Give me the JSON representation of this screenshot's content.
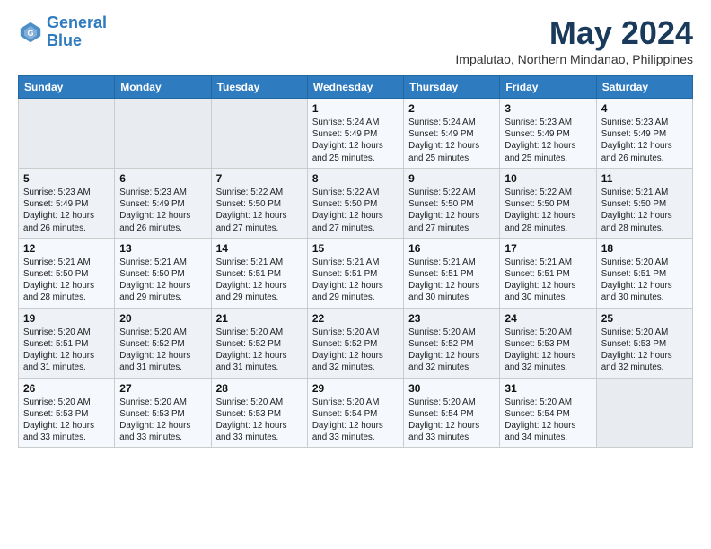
{
  "header": {
    "logo_line1": "General",
    "logo_line2": "Blue",
    "month_title": "May 2024",
    "subtitle": "Impalutao, Northern Mindanao, Philippines"
  },
  "days_of_week": [
    "Sunday",
    "Monday",
    "Tuesday",
    "Wednesday",
    "Thursday",
    "Friday",
    "Saturday"
  ],
  "weeks": [
    [
      {
        "day": "",
        "info": ""
      },
      {
        "day": "",
        "info": ""
      },
      {
        "day": "",
        "info": ""
      },
      {
        "day": "1",
        "info": "Sunrise: 5:24 AM\nSunset: 5:49 PM\nDaylight: 12 hours\nand 25 minutes."
      },
      {
        "day": "2",
        "info": "Sunrise: 5:24 AM\nSunset: 5:49 PM\nDaylight: 12 hours\nand 25 minutes."
      },
      {
        "day": "3",
        "info": "Sunrise: 5:23 AM\nSunset: 5:49 PM\nDaylight: 12 hours\nand 25 minutes."
      },
      {
        "day": "4",
        "info": "Sunrise: 5:23 AM\nSunset: 5:49 PM\nDaylight: 12 hours\nand 26 minutes."
      }
    ],
    [
      {
        "day": "5",
        "info": "Sunrise: 5:23 AM\nSunset: 5:49 PM\nDaylight: 12 hours\nand 26 minutes."
      },
      {
        "day": "6",
        "info": "Sunrise: 5:23 AM\nSunset: 5:49 PM\nDaylight: 12 hours\nand 26 minutes."
      },
      {
        "day": "7",
        "info": "Sunrise: 5:22 AM\nSunset: 5:50 PM\nDaylight: 12 hours\nand 27 minutes."
      },
      {
        "day": "8",
        "info": "Sunrise: 5:22 AM\nSunset: 5:50 PM\nDaylight: 12 hours\nand 27 minutes."
      },
      {
        "day": "9",
        "info": "Sunrise: 5:22 AM\nSunset: 5:50 PM\nDaylight: 12 hours\nand 27 minutes."
      },
      {
        "day": "10",
        "info": "Sunrise: 5:22 AM\nSunset: 5:50 PM\nDaylight: 12 hours\nand 28 minutes."
      },
      {
        "day": "11",
        "info": "Sunrise: 5:21 AM\nSunset: 5:50 PM\nDaylight: 12 hours\nand 28 minutes."
      }
    ],
    [
      {
        "day": "12",
        "info": "Sunrise: 5:21 AM\nSunset: 5:50 PM\nDaylight: 12 hours\nand 28 minutes."
      },
      {
        "day": "13",
        "info": "Sunrise: 5:21 AM\nSunset: 5:50 PM\nDaylight: 12 hours\nand 29 minutes."
      },
      {
        "day": "14",
        "info": "Sunrise: 5:21 AM\nSunset: 5:51 PM\nDaylight: 12 hours\nand 29 minutes."
      },
      {
        "day": "15",
        "info": "Sunrise: 5:21 AM\nSunset: 5:51 PM\nDaylight: 12 hours\nand 29 minutes."
      },
      {
        "day": "16",
        "info": "Sunrise: 5:21 AM\nSunset: 5:51 PM\nDaylight: 12 hours\nand 30 minutes."
      },
      {
        "day": "17",
        "info": "Sunrise: 5:21 AM\nSunset: 5:51 PM\nDaylight: 12 hours\nand 30 minutes."
      },
      {
        "day": "18",
        "info": "Sunrise: 5:20 AM\nSunset: 5:51 PM\nDaylight: 12 hours\nand 30 minutes."
      }
    ],
    [
      {
        "day": "19",
        "info": "Sunrise: 5:20 AM\nSunset: 5:51 PM\nDaylight: 12 hours\nand 31 minutes."
      },
      {
        "day": "20",
        "info": "Sunrise: 5:20 AM\nSunset: 5:52 PM\nDaylight: 12 hours\nand 31 minutes."
      },
      {
        "day": "21",
        "info": "Sunrise: 5:20 AM\nSunset: 5:52 PM\nDaylight: 12 hours\nand 31 minutes."
      },
      {
        "day": "22",
        "info": "Sunrise: 5:20 AM\nSunset: 5:52 PM\nDaylight: 12 hours\nand 32 minutes."
      },
      {
        "day": "23",
        "info": "Sunrise: 5:20 AM\nSunset: 5:52 PM\nDaylight: 12 hours\nand 32 minutes."
      },
      {
        "day": "24",
        "info": "Sunrise: 5:20 AM\nSunset: 5:53 PM\nDaylight: 12 hours\nand 32 minutes."
      },
      {
        "day": "25",
        "info": "Sunrise: 5:20 AM\nSunset: 5:53 PM\nDaylight: 12 hours\nand 32 minutes."
      }
    ],
    [
      {
        "day": "26",
        "info": "Sunrise: 5:20 AM\nSunset: 5:53 PM\nDaylight: 12 hours\nand 33 minutes."
      },
      {
        "day": "27",
        "info": "Sunrise: 5:20 AM\nSunset: 5:53 PM\nDaylight: 12 hours\nand 33 minutes."
      },
      {
        "day": "28",
        "info": "Sunrise: 5:20 AM\nSunset: 5:53 PM\nDaylight: 12 hours\nand 33 minutes."
      },
      {
        "day": "29",
        "info": "Sunrise: 5:20 AM\nSunset: 5:54 PM\nDaylight: 12 hours\nand 33 minutes."
      },
      {
        "day": "30",
        "info": "Sunrise: 5:20 AM\nSunset: 5:54 PM\nDaylight: 12 hours\nand 33 minutes."
      },
      {
        "day": "31",
        "info": "Sunrise: 5:20 AM\nSunset: 5:54 PM\nDaylight: 12 hours\nand 34 minutes."
      },
      {
        "day": "",
        "info": ""
      }
    ]
  ]
}
